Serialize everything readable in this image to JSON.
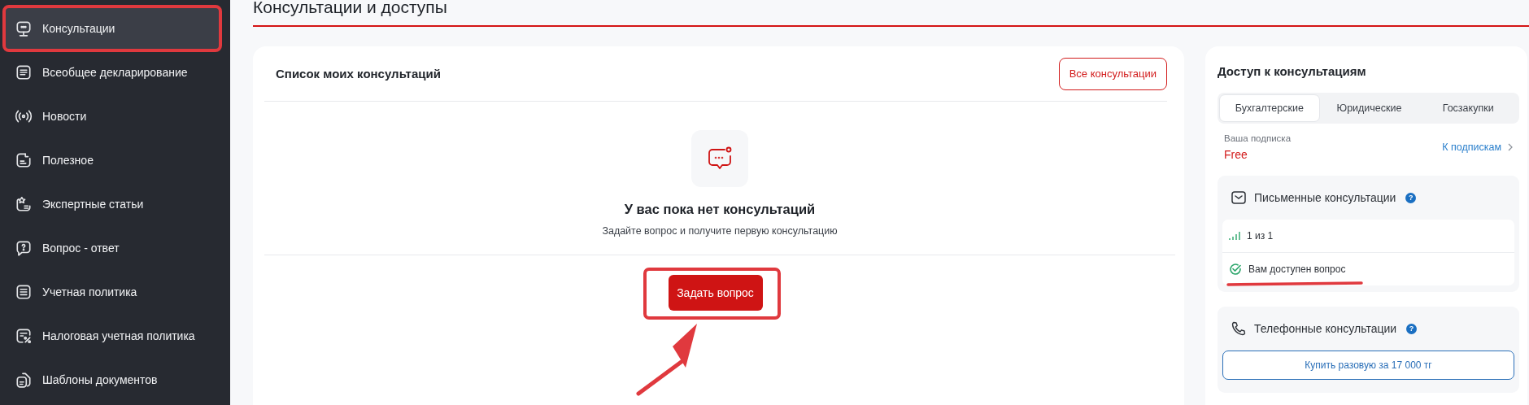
{
  "sidebar": {
    "items": [
      {
        "label": "Консультации",
        "selected": true,
        "annotated": true
      },
      {
        "label": "Всеобщее декларирование",
        "selected": false,
        "annotated": false
      },
      {
        "label": "Новости",
        "selected": false,
        "annotated": false
      },
      {
        "label": "Полезное",
        "selected": false,
        "annotated": false
      },
      {
        "label": "Экспертные статьи",
        "selected": false,
        "annotated": false
      },
      {
        "label": "Вопрос - ответ",
        "selected": false,
        "annotated": false
      },
      {
        "label": "Учетная политика",
        "selected": false,
        "annotated": false
      },
      {
        "label": "Налоговая учетная политика",
        "selected": false,
        "annotated": false
      },
      {
        "label": "Шаблоны документов",
        "selected": false,
        "annotated": false
      }
    ]
  },
  "page_title": "Консультации и доступы",
  "consultations_card": {
    "title": "Список моих консультаций",
    "all_button": "Все консультации",
    "empty_state": {
      "title": "У вас пока нет консультаций",
      "subtitle": "Задайте вопрос и получите первую консультацию"
    },
    "ask_button": {
      "label": "Задать вопрос",
      "annotated": true
    }
  },
  "access_panel": {
    "title": "Доступ к консультациям",
    "tabs": [
      {
        "label": "Бухгалтерские",
        "selected": true
      },
      {
        "label": "Юридические",
        "selected": false
      },
      {
        "label": "Госзакупки",
        "selected": false
      }
    ],
    "subscription": {
      "label": "Ваша подписка",
      "plan": "Free",
      "link": "К подпискам"
    },
    "written": {
      "title": "Письменные консультации",
      "help": "?",
      "count": "1 из 1",
      "status": "Вам доступен вопрос",
      "annotated": true
    },
    "phone": {
      "title": "Телефонные консультации",
      "help": "?",
      "buy_button": "Купить разовую за 17 000 тг"
    }
  }
}
